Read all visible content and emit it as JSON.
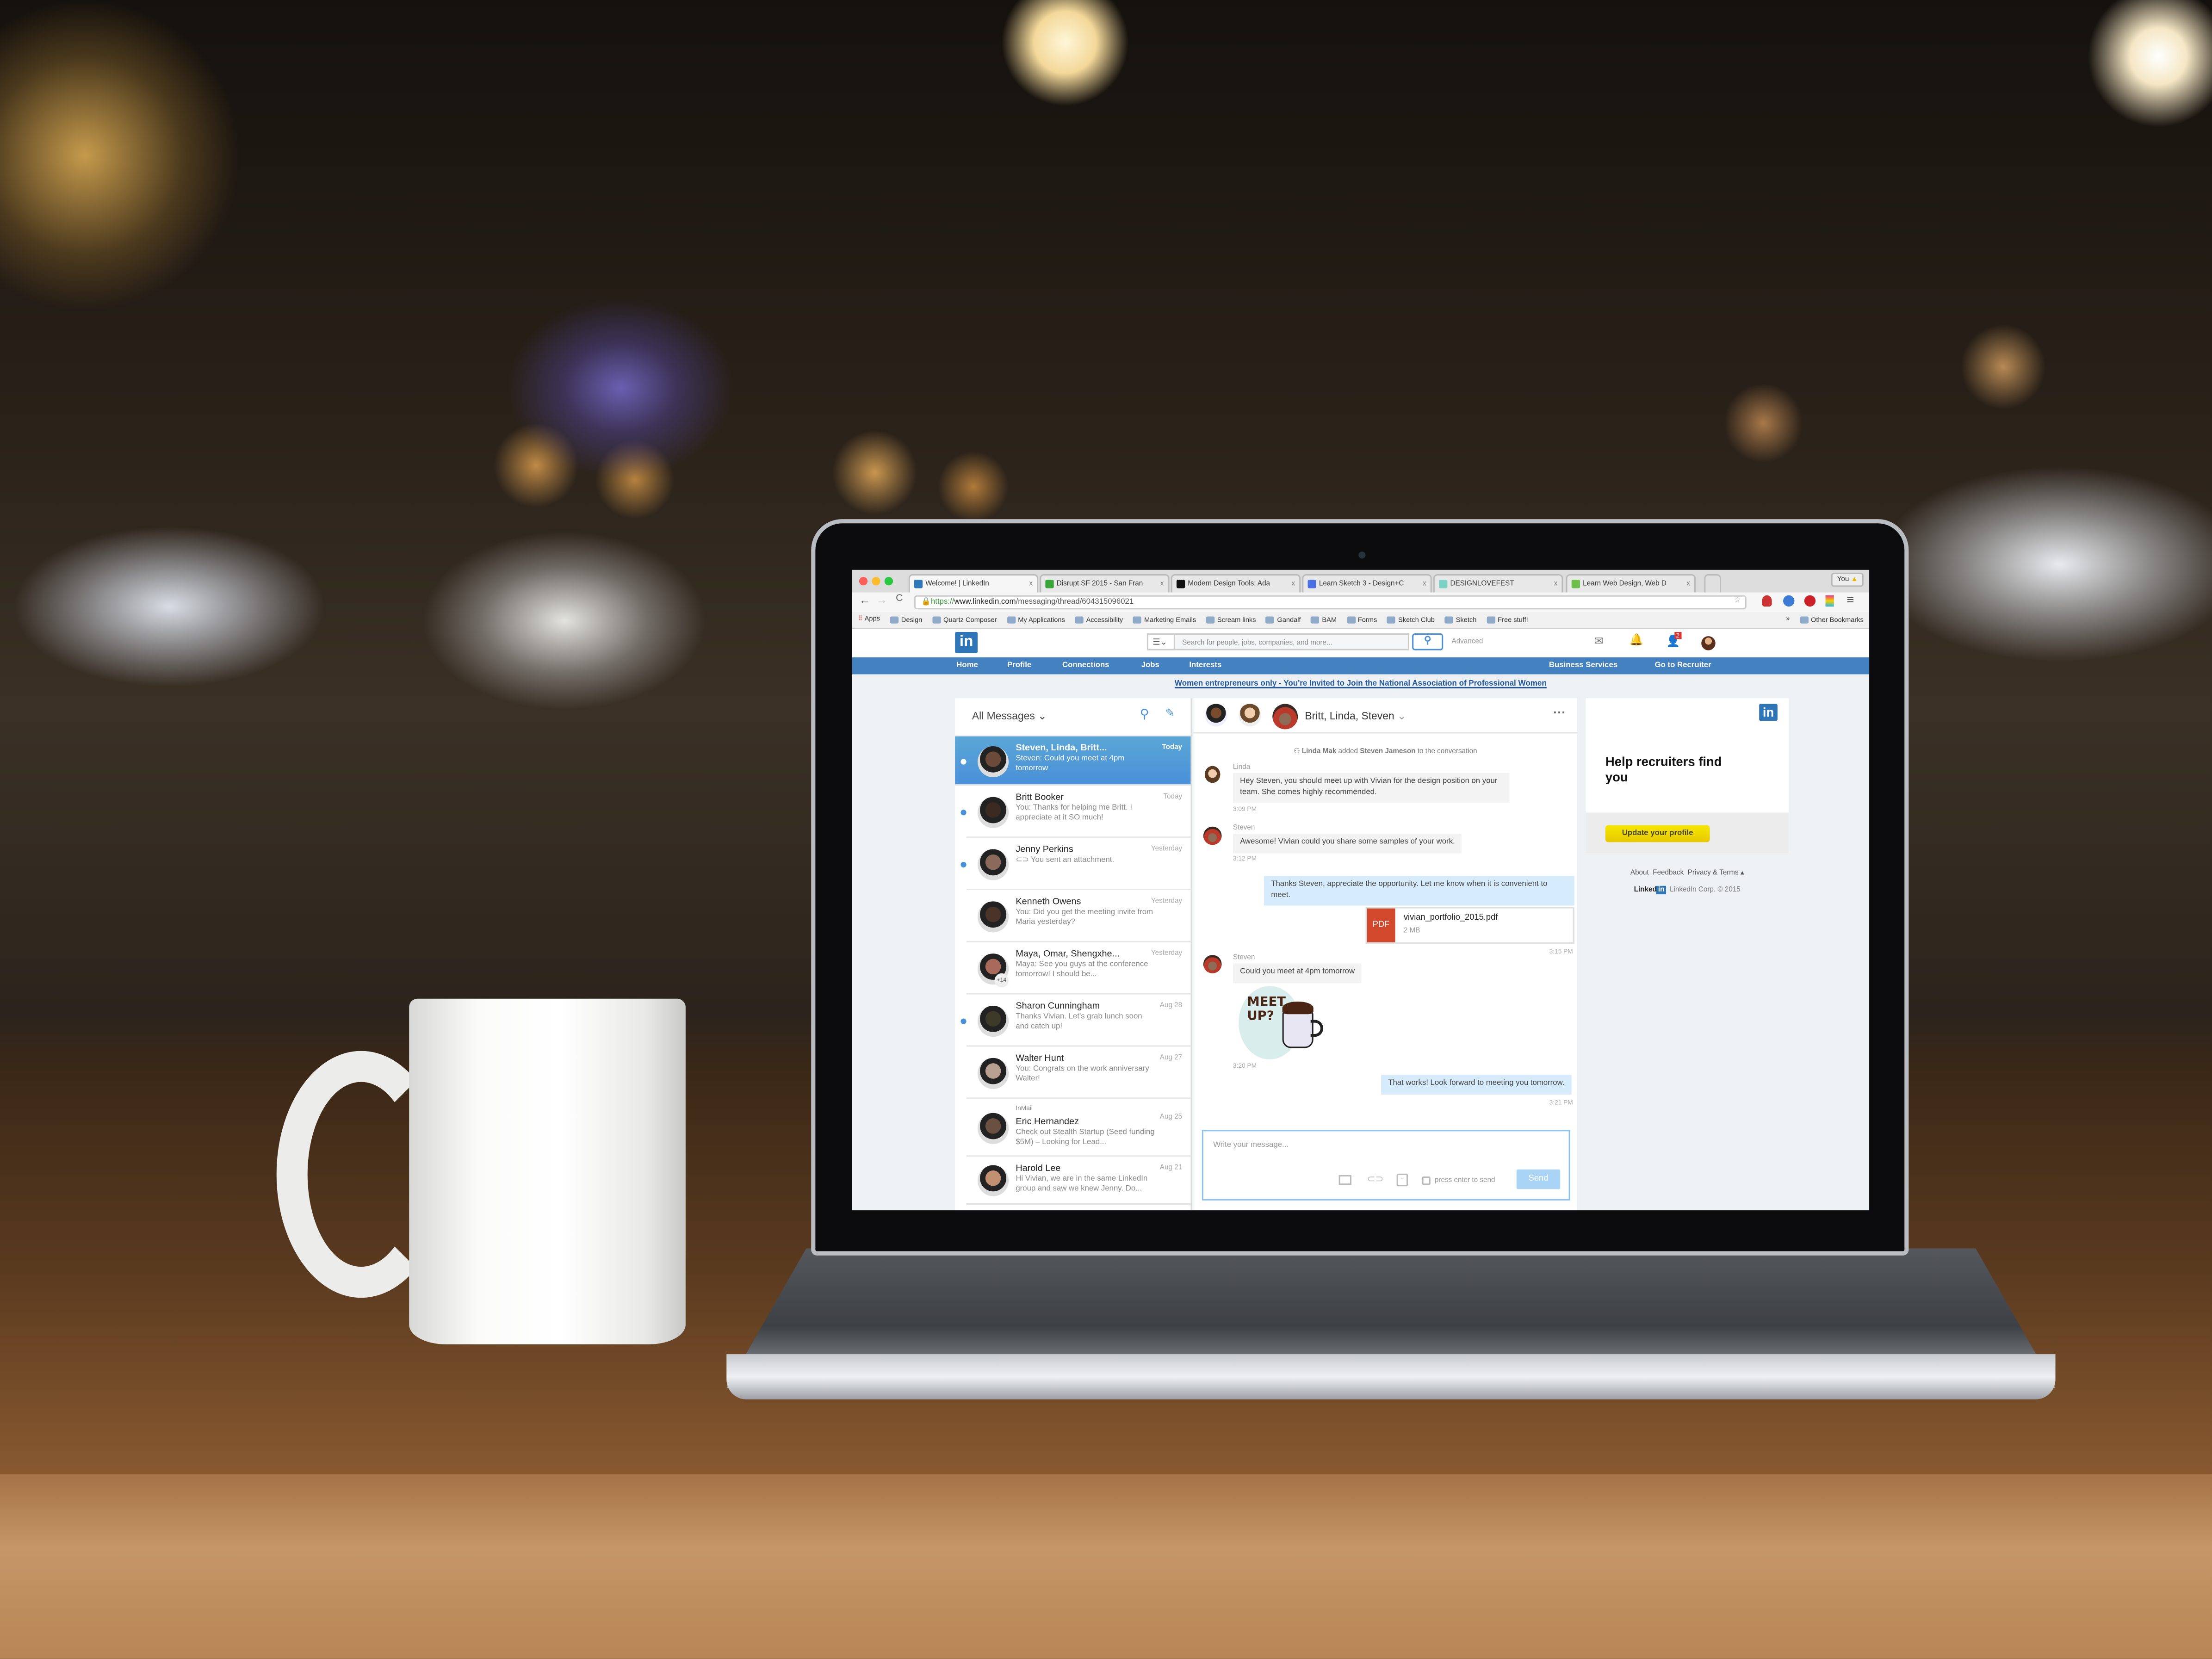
{
  "browser": {
    "tabs": [
      {
        "label": "Welcome! | LinkedIn",
        "color": "#2f76b9",
        "active": true
      },
      {
        "label": "Disrupt SF 2015 - San Fran",
        "color": "#3aa63a"
      },
      {
        "label": "Modern Design Tools: Ada",
        "color": "#111111"
      },
      {
        "label": "Learn Sketch 3 - Design+C",
        "color": "#4a6fe0"
      },
      {
        "label": "DESIGNLOVEFEST",
        "color": "#7fd1c4"
      },
      {
        "label": "Learn Web Design, Web D",
        "color": "#6cc04a"
      }
    ],
    "tab_close": "x",
    "profile_label": "You",
    "url_scheme": "https://",
    "url_host": "www.linkedin.com",
    "url_path": "/messaging/thread/604315096021",
    "bookmarks": [
      "Apps",
      "Design",
      "Quartz Composer",
      "My Applications",
      "Accessibility",
      "Marketing Emails",
      "Scream links",
      "Gandalf",
      "BAM",
      "Forms",
      "Sketch Club",
      "Sketch",
      "Free stuff!"
    ],
    "other_bookmarks": "Other Bookmarks",
    "overflow": "»"
  },
  "header": {
    "logo": "in",
    "search_placeholder": "Search for people, jobs, companies, and more...",
    "advanced": "Advanced",
    "notification_badge": "2",
    "nav": [
      "Home",
      "Profile",
      "Connections",
      "Jobs",
      "Interests"
    ],
    "nav_right": [
      "Business Services",
      "Go to Recruiter"
    ],
    "banner": "Women entrepreneurs only - You're Invited to Join the National Association of Professional Women",
    "brand_color": "#4381c1"
  },
  "messages": {
    "filter": "All Messages",
    "threads": [
      {
        "name": "Steven, Linda, Britt...",
        "preview": "Steven: Could you meet at 4pm tomorrow",
        "date": "Today",
        "unread": true,
        "selected": true
      },
      {
        "name": "Britt Booker",
        "preview": "You: Thanks for helping me Britt. I appreciate at it SO much!",
        "date": "Today",
        "unread": true
      },
      {
        "name": "Jenny Perkins",
        "preview": "You sent an attachment.",
        "date": "Yesterday",
        "unread": true
      },
      {
        "name": "Kenneth Owens",
        "preview": "You: Did you get the meeting invite from Maria yesterday?",
        "date": "Yesterday"
      },
      {
        "name": "Maya, Omar, Shengxhe...",
        "preview": "Maya: See you guys at the conference tomorrow! I should be...",
        "date": "Yesterday",
        "extra": "+14"
      },
      {
        "name": "Sharon Cunningham",
        "preview": "Thanks Vivian. Let's grab lunch soon and catch up!",
        "date": "Aug 28",
        "unread": true
      },
      {
        "name": "Walter Hunt",
        "preview": "You: Congrats on the work anniversary Walter!",
        "date": "Aug 27"
      },
      {
        "name": "Eric Hernandez",
        "tag": "InMail",
        "preview": "Check out Stealth Startup (Seed funding $5M) – Looking for Lead...",
        "date": "Aug 25"
      },
      {
        "name": "Harold Lee",
        "preview": "Hi Vivian, we are in the same LinkedIn group and saw we knew Jenny. Do...",
        "date": "Aug 21"
      }
    ]
  },
  "conversation": {
    "title": "Britt, Linda, Steven",
    "system": {
      "actor": "Linda Mak",
      "verb": "added",
      "target": "Steven Jameson",
      "rest": "to the conversation"
    },
    "msgs": [
      {
        "sender": "Linda",
        "text": "Hey Steven, you should meet up with Vivian for the design position on your team. She comes highly recommended.",
        "time": "3:09 PM"
      },
      {
        "sender": "Steven",
        "text": "Awesome! Vivian could you share some samples of your work.",
        "time": "3:12 PM"
      },
      {
        "text": "Thanks Steven, appreciate the opportunity. Let me know when it is convenient to meet.",
        "mine": true
      },
      {
        "file": "vivian_portfolio_2015.pdf",
        "file_type": "PDF",
        "size": "2 MB",
        "time": "3:15 PM",
        "mine": true
      },
      {
        "sender": "Steven",
        "text": "Could you meet at 4pm tomorrow"
      },
      {
        "sticker_text": [
          "MEET",
          "UP?"
        ],
        "time": "3:20 PM"
      },
      {
        "text": "That works! Look forward to meeting you tomorrow.",
        "time": "3:21 PM",
        "mine": true
      }
    ],
    "compose_placeholder": "Write your message...",
    "enter_to_send": "press enter to send",
    "send": "Send"
  },
  "sidebar": {
    "ad_logo": "in",
    "ad_title": "Help recruiters find you",
    "ad_button": "Update your profile",
    "footer_links": [
      "About",
      "Feedback",
      "Privacy & Terms"
    ],
    "footer_brand": "Linked",
    "footer_brand_in": "in",
    "copyright": "LinkedIn Corp. © 2015"
  }
}
